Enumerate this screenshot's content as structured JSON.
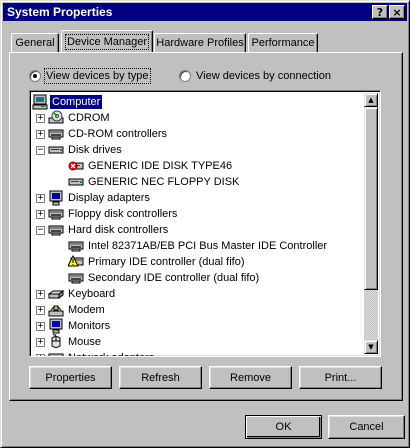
{
  "window": {
    "title": "System Properties",
    "help_glyph": "?",
    "close_glyph": "×"
  },
  "tabs": [
    {
      "label": "General"
    },
    {
      "label": "Device Manager"
    },
    {
      "label": "Hardware Profiles"
    },
    {
      "label": "Performance"
    }
  ],
  "view_options": {
    "by_type": "View devices by type",
    "by_connection": "View devices by connection",
    "selected": "by_type"
  },
  "tree": [
    {
      "label": "Computer",
      "icon": "computer-icon",
      "level": 0,
      "expander": "",
      "selected": true
    },
    {
      "label": "CDROM",
      "icon": "cdrom-icon",
      "level": 1,
      "expander": "+"
    },
    {
      "label": "CD-ROM controllers",
      "icon": "controller-icon",
      "level": 1,
      "expander": "+"
    },
    {
      "label": "Disk drives",
      "icon": "disk-drive-icon",
      "level": 1,
      "expander": "−"
    },
    {
      "label": "GENERIC IDE  DISK TYPE46",
      "icon": "disk-error-icon",
      "level": 2,
      "expander": ""
    },
    {
      "label": "GENERIC NEC  FLOPPY DISK",
      "icon": "disk-drive-icon",
      "level": 2,
      "expander": ""
    },
    {
      "label": "Display adapters",
      "icon": "display-adapter-icon",
      "level": 1,
      "expander": "+"
    },
    {
      "label": "Floppy disk controllers",
      "icon": "controller-icon",
      "level": 1,
      "expander": "+"
    },
    {
      "label": "Hard disk controllers",
      "icon": "controller-icon",
      "level": 1,
      "expander": "−"
    },
    {
      "label": "Intel 82371AB/EB PCI Bus Master IDE Controller",
      "icon": "controller-icon",
      "level": 2,
      "expander": ""
    },
    {
      "label": "Primary IDE controller (dual fifo)",
      "icon": "controller-warning-icon",
      "level": 2,
      "expander": ""
    },
    {
      "label": "Secondary IDE controller (dual fifo)",
      "icon": "controller-icon",
      "level": 2,
      "expander": ""
    },
    {
      "label": "Keyboard",
      "icon": "keyboard-icon",
      "level": 1,
      "expander": "+"
    },
    {
      "label": "Modem",
      "icon": "modem-icon",
      "level": 1,
      "expander": "+"
    },
    {
      "label": "Monitors",
      "icon": "monitor-icon",
      "level": 1,
      "expander": "+"
    },
    {
      "label": "Mouse",
      "icon": "mouse-icon",
      "level": 1,
      "expander": "+"
    },
    {
      "label": "Network adapters",
      "icon": "network-icon",
      "level": 1,
      "expander": "+"
    }
  ],
  "buttons": {
    "properties": "Properties",
    "refresh": "Refresh",
    "remove": "Remove",
    "print": "Print...",
    "ok": "OK",
    "cancel": "Cancel"
  },
  "colors": {
    "titlebar": "#000080",
    "face": "#c0c0c0",
    "selection": "#000080"
  }
}
